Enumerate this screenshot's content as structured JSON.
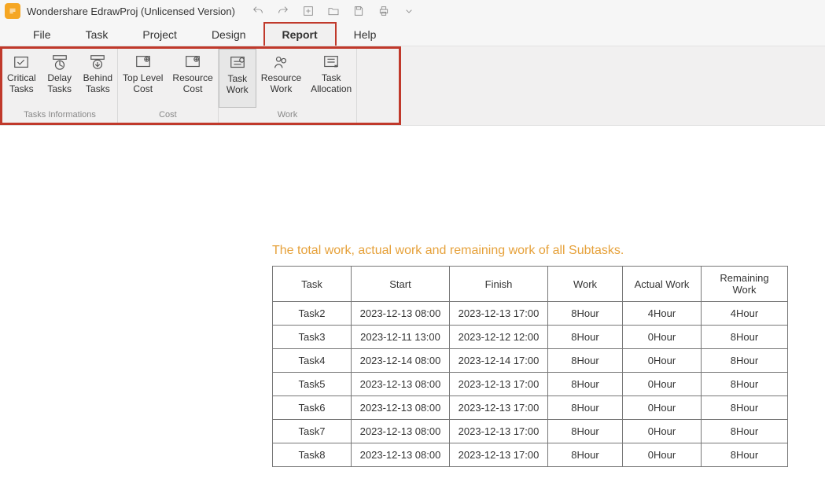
{
  "app": {
    "title": "Wondershare EdrawProj (Unlicensed Version)"
  },
  "qat": {
    "undo": "undo",
    "redo": "redo",
    "new": "new",
    "open": "open",
    "save": "save",
    "print": "print",
    "more": "more"
  },
  "menu": {
    "items": [
      {
        "label": "File"
      },
      {
        "label": "Task"
      },
      {
        "label": "Project"
      },
      {
        "label": "Design"
      },
      {
        "label": "Report"
      },
      {
        "label": "Help"
      }
    ],
    "activeIndex": 4
  },
  "ribbon": {
    "groups": [
      {
        "label": "Tasks Informations",
        "buttons": [
          {
            "l1": "Critical",
            "l2": "Tasks",
            "name": "critical-tasks-button",
            "icon": "critical"
          },
          {
            "l1": "Delay",
            "l2": "Tasks",
            "name": "delay-tasks-button",
            "icon": "delay"
          },
          {
            "l1": "Behind",
            "l2": "Tasks",
            "name": "behind-tasks-button",
            "icon": "behind"
          }
        ]
      },
      {
        "label": "Cost",
        "buttons": [
          {
            "l1": "Top Level",
            "l2": "Cost",
            "name": "top-level-cost-button",
            "icon": "cost"
          },
          {
            "l1": "Resource",
            "l2": "Cost",
            "name": "resource-cost-button",
            "icon": "cost"
          }
        ]
      },
      {
        "label": "Work",
        "buttons": [
          {
            "l1": "Task",
            "l2": "Work",
            "name": "task-work-button",
            "icon": "taskwork",
            "active": true
          },
          {
            "l1": "Resource",
            "l2": "Work",
            "name": "resource-work-button",
            "icon": "reswork"
          },
          {
            "l1": "Task",
            "l2": "Allocation",
            "name": "task-allocation-button",
            "icon": "alloc"
          }
        ]
      }
    ]
  },
  "report": {
    "title": "The total work, actual work and remaining work of all Subtasks.",
    "columns": [
      "Task",
      "Start",
      "Finish",
      "Work",
      "Actual Work",
      "Remaining Work"
    ],
    "rows": [
      {
        "task": "Task2",
        "start": "2023-12-13 08:00",
        "finish": "2023-12-13 17:00",
        "work": "8Hour",
        "actual": "4Hour",
        "remaining": "4Hour"
      },
      {
        "task": "Task3",
        "start": "2023-12-11 13:00",
        "finish": "2023-12-12 12:00",
        "work": "8Hour",
        "actual": "0Hour",
        "remaining": "8Hour"
      },
      {
        "task": "Task4",
        "start": "2023-12-14 08:00",
        "finish": "2023-12-14 17:00",
        "work": "8Hour",
        "actual": "0Hour",
        "remaining": "8Hour"
      },
      {
        "task": "Task5",
        "start": "2023-12-13 08:00",
        "finish": "2023-12-13 17:00",
        "work": "8Hour",
        "actual": "0Hour",
        "remaining": "8Hour"
      },
      {
        "task": "Task6",
        "start": "2023-12-13 08:00",
        "finish": "2023-12-13 17:00",
        "work": "8Hour",
        "actual": "0Hour",
        "remaining": "8Hour"
      },
      {
        "task": "Task7",
        "start": "2023-12-13 08:00",
        "finish": "2023-12-13 17:00",
        "work": "8Hour",
        "actual": "0Hour",
        "remaining": "8Hour"
      },
      {
        "task": "Task8",
        "start": "2023-12-13 08:00",
        "finish": "2023-12-13 17:00",
        "work": "8Hour",
        "actual": "0Hour",
        "remaining": "8Hour"
      }
    ]
  }
}
